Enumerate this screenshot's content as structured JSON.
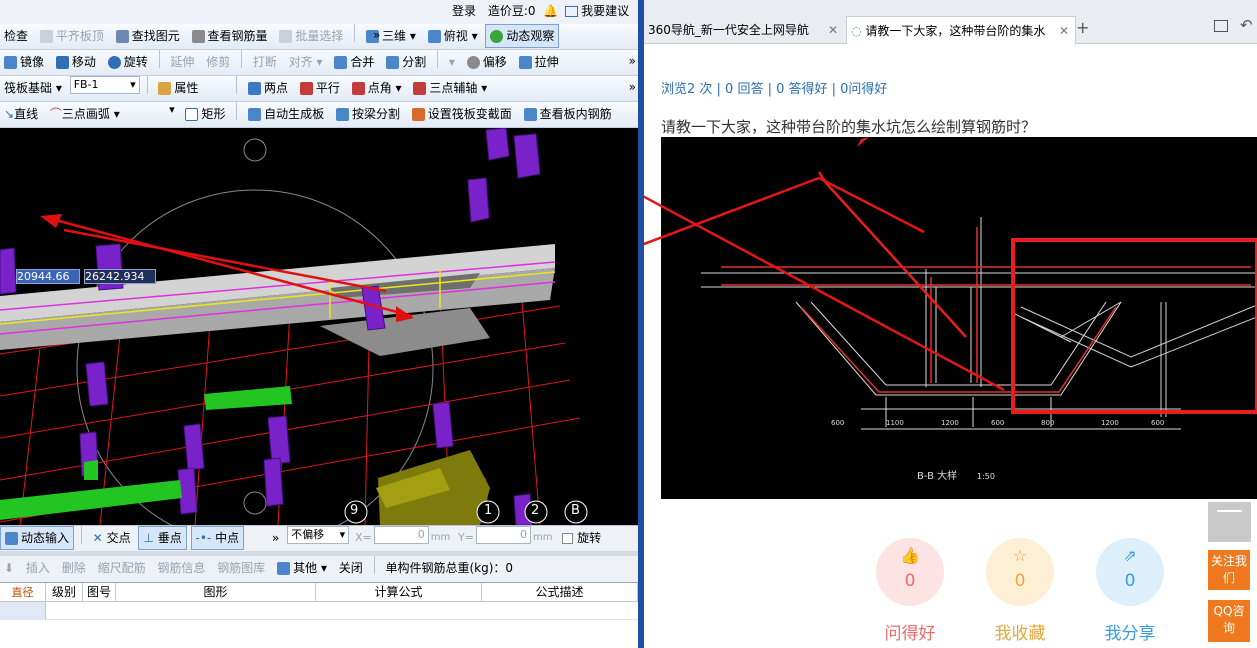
{
  "left_app": {
    "login": {
      "login_label": "登录",
      "price_beans": "造价豆:0",
      "suggest_label": "我要建议"
    },
    "row1": {
      "check": "检查",
      "flush_slab_top": "平齐板顶",
      "find_element": "查找图元",
      "view_rebar_qty": "查看钢筋量",
      "batch_select": "批量选择",
      "view3d": "三维",
      "top_view": "俯视",
      "dynamic_observe": "动态观察"
    },
    "row2": {
      "mirror": "镜像",
      "move": "移动",
      "rotate": "旋转",
      "extend": "延伸",
      "trim": "修剪",
      "break": "打断",
      "align": "对齐",
      "merge": "合并",
      "split": "分割",
      "offset": "偏移",
      "stretch": "拉伸"
    },
    "row3": {
      "category": "筏板基础",
      "component": "FB-1",
      "properties": "属性",
      "two_points": "两点",
      "parallel": "平行",
      "point_angle": "点角",
      "three_point_axis": "三点辅轴"
    },
    "row4": {
      "line": "直线",
      "arc": "三点画弧",
      "rect": "矩形",
      "auto_generate_slab": "自动生成板",
      "split_by_beam": "按梁分割",
      "set_raft_section": "设置筏板变截面",
      "view_slab_rebar": "查看板内钢筋"
    },
    "coords": {
      "x": "20944.66",
      "y": "26242.934"
    },
    "axis_labels": [
      "9",
      "1",
      "2",
      "B"
    ],
    "statusbar": {
      "dynamic_input": "动态输入",
      "intersection": "交点",
      "perpendicular": "垂点",
      "midpoint": "中点",
      "offset_mode": "不偏移",
      "x_label": "X=",
      "x_value": "0",
      "y_label": "Y=",
      "y_value": "0",
      "unit": "mm",
      "rotate_label": "旋转"
    },
    "rebar_bar": {
      "insert": "插入",
      "delete": "删除",
      "scale_rebar": "缩尺配筋",
      "rebar_info": "钢筋信息",
      "rebar_library": "钢筋图库",
      "other": "其他",
      "close": "关闭",
      "total_weight": "单构件钢筋总重(kg)：0"
    },
    "table_headers": [
      "直径(mm)",
      "级别",
      "图号",
      "图形",
      "计算公式",
      "公式描述"
    ]
  },
  "browser": {
    "tabs": [
      {
        "label": "360导航_新一代安全上网导航"
      },
      {
        "label": "请教一下大家，这种带台阶的集水"
      }
    ],
    "stats": "浏览2 次 | 0 回答 | 0 答得好 | 0问得好",
    "question_title": "请教一下大家，这种带台阶的集水坑怎么绘制算钢筋时？",
    "cad_caption": "B-B 大样",
    "cad_scale": "1:50",
    "actions": [
      {
        "count": "0",
        "label": "问得好",
        "icon": "thumbs-up-icon",
        "color": "#ee6b6b",
        "bg": "#fde3e3"
      },
      {
        "count": "0",
        "label": "我收藏",
        "icon": "star-icon",
        "color": "#e9a83a",
        "bg": "#fdefd6"
      },
      {
        "count": "0",
        "label": "我分享",
        "icon": "share-icon",
        "color": "#3b9de1",
        "bg": "#ddeffb"
      }
    ],
    "side_buttons": {
      "follow": "关注我们",
      "qq": "QQ咨询"
    }
  }
}
